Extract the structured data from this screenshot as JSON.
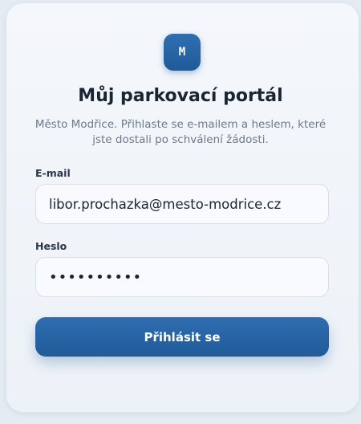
{
  "app": {
    "logo_text": "M",
    "title": "Můj parkovací portál",
    "subtitle": "Město Modřice. Přihlaste se e-mailem a heslem, které jste dostali po schválení žádosti."
  },
  "form": {
    "email": {
      "label": "E-mail",
      "value": "libor.prochazka@mesto-modrice.cz"
    },
    "password": {
      "label": "Heslo",
      "masked_value": "••••••••••"
    },
    "submit_label": "Přihlásit se"
  },
  "colors": {
    "accent": "#2a67a8",
    "background": "#e4ebf3",
    "card": "#f1f5fa"
  }
}
